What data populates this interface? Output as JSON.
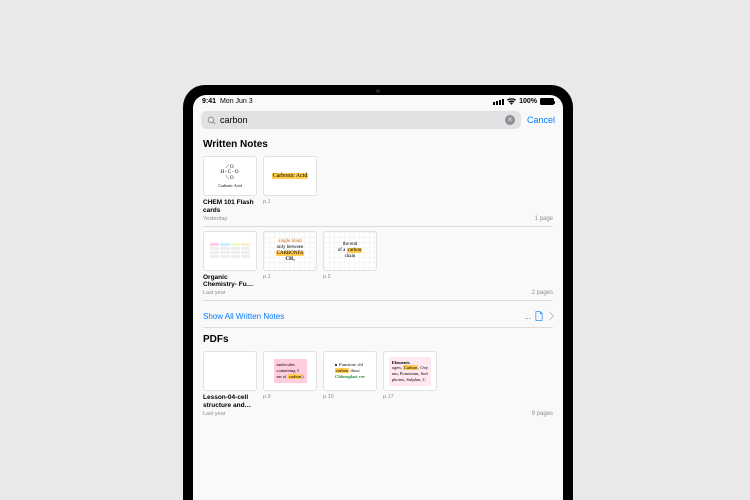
{
  "status": {
    "time": "9:41",
    "date": "Mon Jun 3",
    "battery": "100%"
  },
  "search": {
    "value": "carbon",
    "placeholder": "Search",
    "cancel": "Cancel"
  },
  "sections": {
    "written": {
      "heading": "Written Notes",
      "show_all": "Show All Written Notes",
      "show_all_count": "..."
    },
    "pdfs": {
      "heading": "PDFs"
    }
  },
  "results": {
    "written": [
      {
        "title": "CHEM 101 Flash cards",
        "subtitle": "Yesterday",
        "pages_label": "1 page",
        "thumbs": [
          {
            "kind": "molecule",
            "label": "Carbonic Acid"
          },
          {
            "kind": "hand",
            "text": "Carbonic Acid",
            "page": "p.1"
          }
        ]
      },
      {
        "title": "Organic Chemistry- Fu…",
        "subtitle": "Last year",
        "pages_label": "2 pages",
        "thumbs": [
          {
            "kind": "table"
          },
          {
            "kind": "grid",
            "lines": [
              "single bond",
              "only between",
              "CARBONES",
              "CH₃"
            ],
            "page": "p.1"
          },
          {
            "kind": "grid",
            "lines": [
              "the end",
              "of a carbon",
              "chain"
            ],
            "page": "p.2"
          }
        ]
      }
    ],
    "pdfs": [
      {
        "title": "Lesson-04-cell structure and…",
        "subtitle": "Last year",
        "pages_label": "9 pages",
        "thumbs": [
          {
            "kind": "pdfdoc"
          },
          {
            "kind": "snippet",
            "html": "molecules<br>containing 3<br>ms of <span class='hl'>carbon</span>)",
            "page": "p.9"
          },
          {
            "kind": "snippet",
            "html": "<span class='dot'></span>Function: chl<br><span class='hl'>carbon</span> dioxi<br><span class='green'>Chloroplast ver</span>",
            "page": "p.10"
          },
          {
            "kind": "snippet",
            "html": "<b>Elements</b><br>ogen, <span class='hl'>Carbon</span>, Oxy<br>um, Potassium, Sod<br>phorus, Sulphur, C",
            "page": "p.17"
          }
        ]
      }
    ]
  }
}
